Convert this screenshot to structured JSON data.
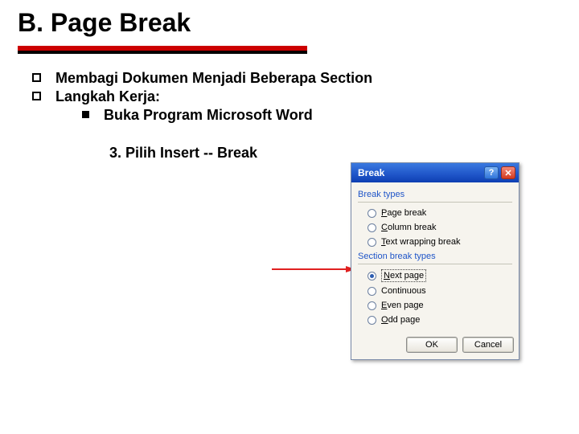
{
  "title": "B. Page Break",
  "bullets": {
    "b1": "Membagi Dokumen Menjadi Beberapa Section",
    "b2": "Langkah Kerja:",
    "b2_sub1": "Buka Program Microsoft Word"
  },
  "step3": "3. Pilih Insert -- Break",
  "dialog": {
    "title": "Break",
    "help_char": "?",
    "close_char": "✕",
    "group1_label": "Break types",
    "opt_page_break_pre": "P",
    "opt_page_break_post": "age break",
    "opt_column_break_pre": "C",
    "opt_column_break_post": "olumn break",
    "opt_text_wrap_pre": "T",
    "opt_text_wrap_post": "ext wrapping break",
    "group2_label": "Section break types",
    "opt_next_page_pre": "N",
    "opt_next_page_post": "ext page",
    "opt_continuous_pre": "Continuous",
    "opt_even_pre": "E",
    "opt_even_post": "ven page",
    "opt_odd_pre": "O",
    "opt_odd_post": "dd page",
    "ok": "OK",
    "cancel": "Cancel"
  }
}
